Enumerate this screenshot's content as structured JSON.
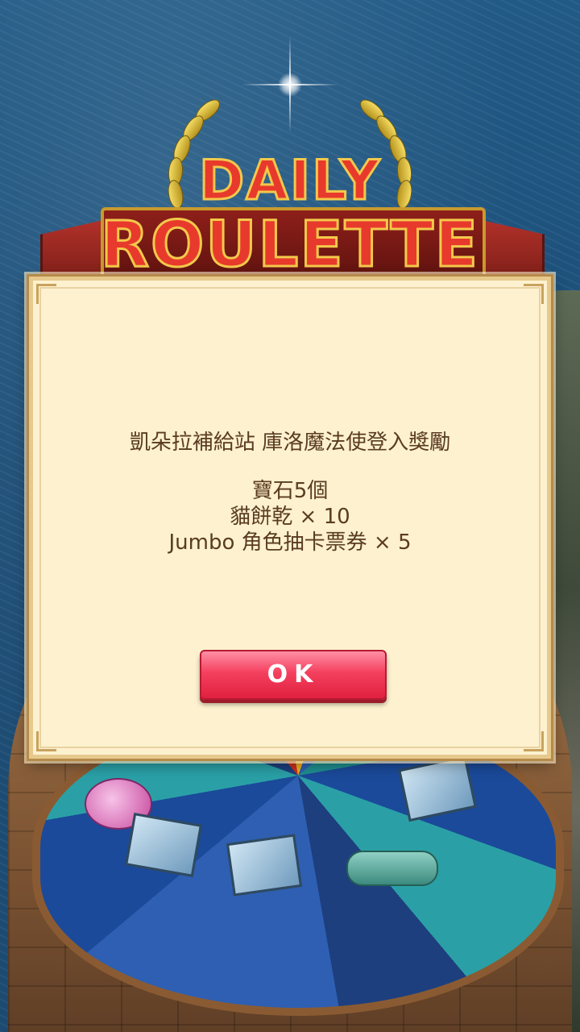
{
  "logo": {
    "line1": "DAILY",
    "line2": "ROULETTE"
  },
  "dialog": {
    "title": "凱朵拉補給站 庫洛魔法使登入獎勵",
    "rewards": [
      "寶石5個",
      "貓餅乾 × 10",
      "Jumbo 角色抽卡票券 × 5"
    ],
    "ok_label": "OK"
  },
  "colors": {
    "dialog_bg": "#fdf1cf",
    "dialog_text": "#5a3b22",
    "ok_button": "#e0213f",
    "logo_red": "#e83a2c",
    "logo_gold": "#f3c94b"
  },
  "icons": [
    "sparkle-icon",
    "laurel-left-icon",
    "laurel-right-icon",
    "gem-icon",
    "ticket-icon",
    "bone-icon"
  ]
}
